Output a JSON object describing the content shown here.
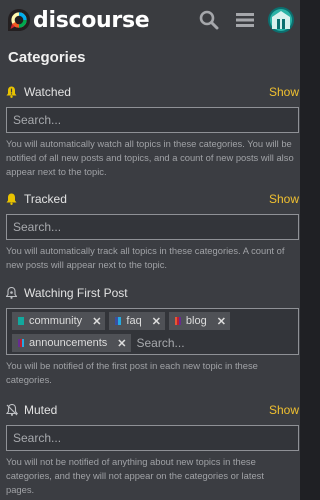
{
  "header": {
    "logo_text": "discourse",
    "icons": [
      "search-icon",
      "hamburger-menu-icon",
      "user-avatar"
    ]
  },
  "page": {
    "title": "Categories"
  },
  "sections": [
    {
      "title": "Watched",
      "icon": "exclamation-bell-icon",
      "show_label": "Show",
      "placeholder": "Search...",
      "description": "You will automatically watch all topics in these categories. You will be notified of all new posts and topics, and a count of new posts will also appear next to the topic."
    },
    {
      "title": "Tracked",
      "icon": "bell-icon",
      "show_label": "Show",
      "placeholder": "Search...",
      "description": "You will automatically track all topics in these categories. A count of new posts will appear next to the topic."
    },
    {
      "title": "Watching First Post",
      "icon": "dot-bell-icon",
      "tags": [
        {
          "name": "community",
          "colors": [
            "#12a89d"
          ]
        },
        {
          "name": "faq",
          "colors": [
            "#3a4fa0",
            "#25aae1"
          ]
        },
        {
          "name": "blog",
          "colors": [
            "#e45735",
            "#bf1e2e",
            "#652d90"
          ]
        },
        {
          "name": "announcements",
          "colors": [
            "#652d90",
            "#bf1e2e",
            "#25aae1"
          ]
        }
      ],
      "placeholder": "Search...",
      "description": "You will be notified of the first post in each new topic in these categories."
    },
    {
      "title": "Muted",
      "icon": "bell-slash-icon",
      "show_label": "Show",
      "placeholder": "Search...",
      "description": "You will not be notified of anything about new topics in these categories, and they will not appear on the categories or latest pages."
    }
  ],
  "colors": {
    "accent": "#f0c030",
    "background": "#3b3d42",
    "header": "#3a3c40"
  }
}
